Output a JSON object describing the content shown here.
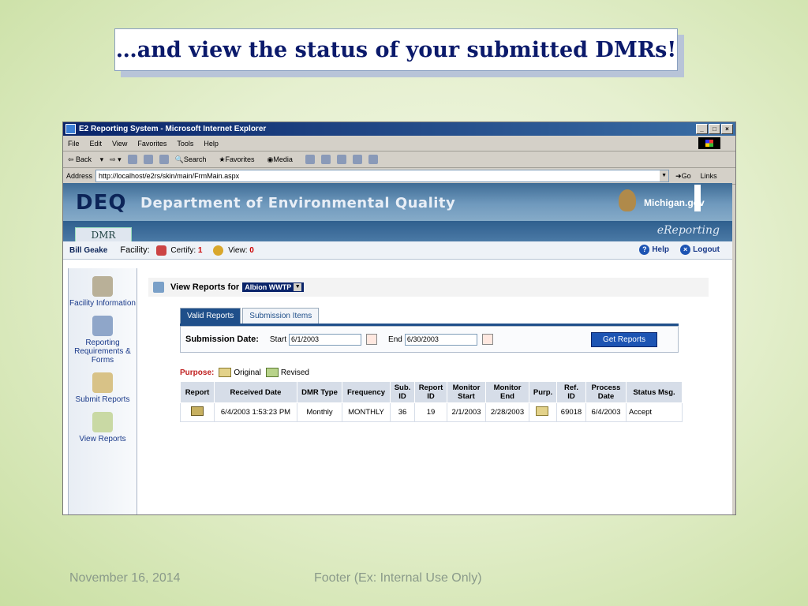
{
  "slide": {
    "title": "…and view the status of your submitted DMRs!",
    "footer_date": "November 16, 2014",
    "footer_note": "Footer (Ex: Internal Use Only)"
  },
  "browser": {
    "window_title": "E2 Reporting System - Microsoft Internet Explorer",
    "menu": [
      "File",
      "Edit",
      "View",
      "Favorites",
      "Tools",
      "Help"
    ],
    "toolbar": [
      "Back",
      "Search",
      "Favorites",
      "Media"
    ],
    "address_label": "Address",
    "url": "http://localhost/e2rs/skin/main/FrmMain.aspx",
    "go_label": "Go",
    "links_label": "Links"
  },
  "site": {
    "logo": "DEQ",
    "title": "Department of Environmental Quality",
    "michigan": "Michigan.gov",
    "tab": "DMR",
    "ereporting": "eReporting",
    "user": "Bill Geake",
    "facility_label": "Facility:",
    "certify_label": "Certify:",
    "certify_count": "1",
    "view_label": "View:",
    "view_count": "0",
    "help": "Help",
    "logout": "Logout"
  },
  "nav": [
    {
      "label": "Facility Information"
    },
    {
      "label": "Reporting Requirements & Forms"
    },
    {
      "label": "Submit Reports"
    },
    {
      "label": "View Reports"
    }
  ],
  "main": {
    "view_reports_label": "View Reports for",
    "facility_select": "Albion WWTP",
    "tabs": [
      "Valid Reports",
      "Submission Items"
    ],
    "submission_date_label": "Submission Date:",
    "start_label": "Start",
    "start_value": "6/1/2003",
    "end_label": "End",
    "end_value": "6/30/2003",
    "get_reports": "Get Reports",
    "purpose_label": "Purpose:",
    "purpose_original": "Original",
    "purpose_revised": "Revised"
  },
  "table": {
    "headers": [
      "Report",
      "Received Date",
      "DMR Type",
      "Frequency",
      "Sub. ID",
      "Report ID",
      "Monitor Start",
      "Monitor End",
      "Purp.",
      "Ref. ID",
      "Process Date",
      "Status Msg."
    ],
    "rows": [
      [
        "",
        "6/4/2003 1:53:23 PM",
        "Monthly",
        "MONTHLY",
        "36",
        "19",
        "2/1/2003",
        "2/28/2003",
        "",
        "69018",
        "6/4/2003",
        "Accept"
      ]
    ]
  }
}
